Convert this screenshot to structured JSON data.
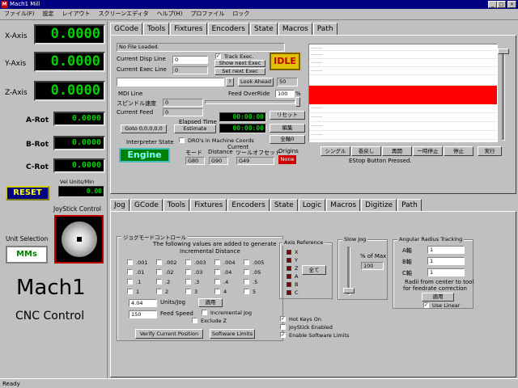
{
  "window": {
    "title": "Mach1 Mill",
    "min": "_",
    "max": "□",
    "close": "×"
  },
  "menu": [
    "ファイル(F)",
    "設定",
    "レイアウト",
    "スクリーンエディタ",
    "ヘルプ(H)",
    "プロファイル",
    "ロック"
  ],
  "axes": [
    {
      "label": "X-Axis",
      "value": "0.0000"
    },
    {
      "label": "Y-Axis",
      "value": "0.0000"
    },
    {
      "label": "Z-Axis",
      "value": "0.0000"
    },
    {
      "label": "A-Rot",
      "value": "0.0000"
    },
    {
      "label": "B-Rot",
      "value": "0.0000"
    },
    {
      "label": "C-Rot",
      "value": "0.0000"
    }
  ],
  "reset_label": "RESET",
  "vel": {
    "label": "Vel Units/Min",
    "value": "0.00"
  },
  "joystick_label": "JoyStick Control",
  "unit_selection": {
    "label": "Unit Selection",
    "value": "MMs"
  },
  "brand": {
    "title": "Mach1",
    "subtitle": "CNC Control"
  },
  "top_tabs": [
    "GCode",
    "Tools",
    "Fixtures",
    "Encoders",
    "State",
    "Macros",
    "Path"
  ],
  "gcode": {
    "file_status": "No File Loaded.",
    "current_disp_line_label": "Current Disp Line",
    "current_disp_line_value": "0",
    "current_exec_line_label": "Current Exec Line",
    "current_exec_line_value": "0",
    "track_exec_label": "Track Exec.",
    "show_next_exec": "Show next Exec",
    "set_next_exec": "Set next Exec",
    "idle_label": "IDLE",
    "question": "?",
    "look_ahead": "Look Ahead",
    "look_ahead_value": "50",
    "mdi_line": "MDI Line",
    "feed_override_label": "Feed OverRide",
    "feed_override_value": "100",
    "feed_override_unit": "%",
    "spindle_speed_label": "スピンドル速度",
    "spindle_speed_value": "0",
    "current_feed_label": "Current Feed",
    "current_feed_value": "0",
    "reset_btn": "リセット",
    "goto_btn": "Goto 0,0,0,0,0",
    "elapsed_label": "Elapsed Time",
    "elapsed_value": "00:00:00",
    "estimate_btn": "Estimate",
    "estimate_value": "00:00:00",
    "edit_btn": "編集",
    "all_zero_btn": "全軸0",
    "interpreter_label": "Interpreter State",
    "engine_label": "Engine",
    "dro_machine_label": "DRO's in Machine Coords",
    "current_label": "Current",
    "mode_label": "モード",
    "mode_value": "G80",
    "distance_label": "Distance",
    "distance_value": "G90",
    "tool_offset_label": "ツールオフセット",
    "tool_offset_value": "G49",
    "origins_label": "Origins",
    "origins_value": "None",
    "line_dash": "--------",
    "run_buttons": [
      "シングル",
      "巻戻し",
      "再開",
      "一時停止",
      "停止",
      "実行"
    ],
    "estop_status": "EStop Button Pressed."
  },
  "bottom_tabs": [
    "Jog",
    "GCode",
    "Tools",
    "Fixtures",
    "Encoders",
    "State",
    "Logic",
    "Macros",
    "Digitize",
    "Path"
  ],
  "jog": {
    "group_title": "ジョグモードコントロール",
    "desc1": "The following values are added to generate",
    "desc2": "Incremental Distance",
    "increments": [
      [
        ".001",
        ".002",
        ".003",
        ".004",
        ".005"
      ],
      [
        ".01",
        ".02",
        ".03",
        ".04",
        ".05"
      ],
      [
        ".1",
        ".2",
        ".3",
        ".4",
        ".5"
      ],
      [
        "1",
        "2",
        "3",
        "4",
        "5"
      ]
    ],
    "units_value": "4.04",
    "units_label": "Units/Jog",
    "apply_btn": "適用",
    "feed_value": "150",
    "feed_label": "Feed Speed",
    "incremental_label": "Incremental Jog",
    "exclude_z_label": "Exclude Z",
    "verify_btn": "Verify Current Position",
    "limits_btn": "Software Limits",
    "axis_ref_title": "Axis Reference",
    "axis_refs": [
      "X",
      "Y",
      "Z",
      "A",
      "B",
      "C"
    ],
    "all_btn": "全て",
    "slow_jog_title": "Slow Jog",
    "pct_max_label": "% of Max",
    "pct_max_value": "100",
    "hotkeys_label": "Hot Keys On",
    "joystick_enabled_label": "JoyStick Enabled",
    "enable_limits_label": "Enable Software Limits",
    "angular_title": "Angular Radius Tracking",
    "angular_rows": [
      {
        "label": "A軸",
        "value": "1"
      },
      {
        "label": "B軸",
        "value": "1"
      },
      {
        "label": "C軸",
        "value": "1"
      }
    ],
    "radii_desc1": "Radii from center to tool",
    "radii_desc2": "for feedrate correction",
    "angular_apply": "適用",
    "use_linear_label": "Use Linear"
  },
  "status_bar": "Ready",
  "colors": {
    "lcd_text": "#00d000",
    "idle_bg": "#e0c000",
    "idle_text": "#c00000",
    "highlight_row": "#ff0000",
    "reset_bg": "#000080",
    "reset_text": "#ffff00",
    "origins_bg": "#d00000",
    "engine_bg": "#008000"
  }
}
